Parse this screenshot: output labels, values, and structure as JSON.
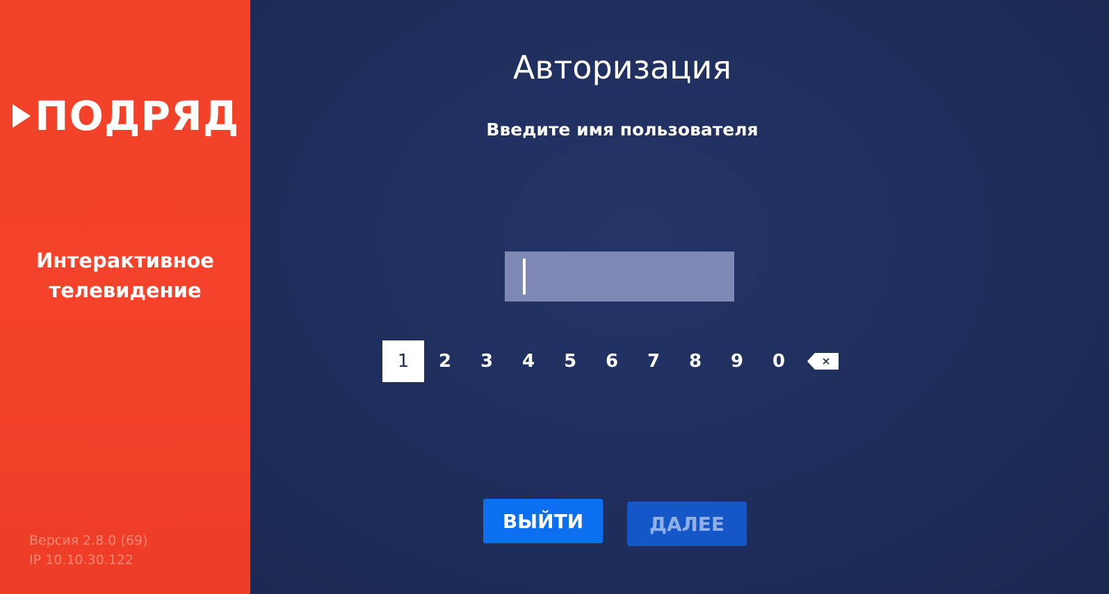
{
  "sidebar": {
    "logo_text": "ПОДРЯД",
    "tagline_line1": "Интерактивное",
    "tagline_line2": "телевидение",
    "version": "Версия 2.8.0 (69)",
    "ip": "IP 10.10.30.122"
  },
  "main": {
    "title": "Авторизация",
    "subtitle": "Введите имя пользователя",
    "username_value": "",
    "keypad": [
      "1",
      "2",
      "3",
      "4",
      "5",
      "6",
      "7",
      "8",
      "9",
      "0"
    ],
    "active_key": "1",
    "backspace_icon": "backspace-icon"
  },
  "buttons": {
    "exit_label": "ВЫЙТИ",
    "next_label": "ДАЛЕЕ"
  },
  "colors": {
    "sidebar": "#f24129",
    "background": "#1f2e5a",
    "primary_button": "#0b6ff0",
    "secondary_button": "#1457c9"
  }
}
